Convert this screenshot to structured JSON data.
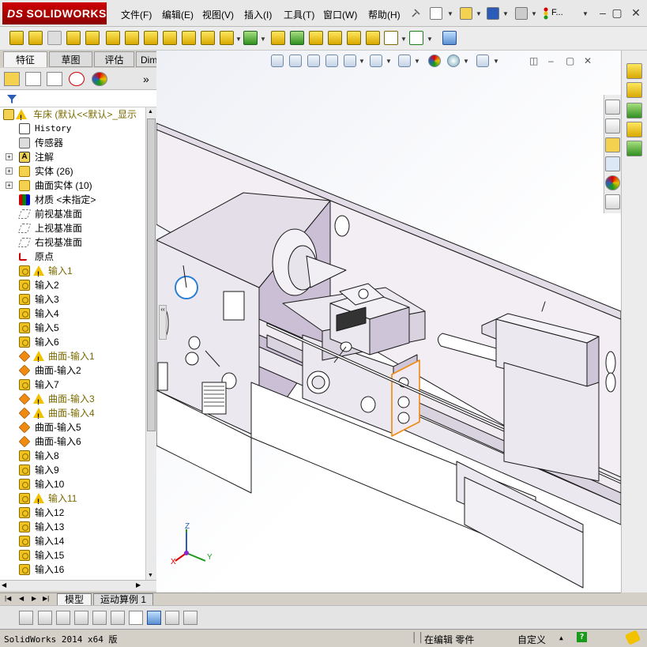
{
  "app": {
    "logo_ds": "DS",
    "logo_text": "SOLIDWORKS",
    "menu": [
      "文件(F)",
      "编辑(E)",
      "视图(V)",
      "插入(I)",
      "工具(T)",
      "窗口(W)",
      "帮助(H)"
    ],
    "quick_extra": "F..."
  },
  "panel_tabs": [
    "特征",
    "草图",
    "评估",
    "DimXpert"
  ],
  "tree": {
    "root": "车床  (默认<<默认>_显示",
    "items": [
      {
        "label": "History",
        "icon": "history-icon",
        "expand": false,
        "warn": false
      },
      {
        "label": "传感器",
        "icon": "sensor-icon",
        "expand": false,
        "warn": false
      },
      {
        "label": "注解",
        "icon": "annotation-icon",
        "expand": true,
        "warn": false
      },
      {
        "label": "实体 (26)",
        "icon": "solid-bodies-icon",
        "expand": true,
        "warn": false
      },
      {
        "label": "曲面实体 (10)",
        "icon": "surface-bodies-icon",
        "expand": true,
        "warn": false
      },
      {
        "label": "材质 <未指定>",
        "icon": "material-icon",
        "expand": false,
        "warn": false
      },
      {
        "label": "前视基准面",
        "icon": "plane-icon",
        "expand": false,
        "warn": false
      },
      {
        "label": "上视基准面",
        "icon": "plane-icon",
        "expand": false,
        "warn": false
      },
      {
        "label": "右视基准面",
        "icon": "plane-icon",
        "expand": false,
        "warn": false
      },
      {
        "label": "原点",
        "icon": "origin-icon",
        "expand": false,
        "warn": false
      },
      {
        "label": "输入1",
        "icon": "import-icon",
        "expand": false,
        "warn": true
      },
      {
        "label": "输入2",
        "icon": "import-icon",
        "expand": false,
        "warn": false
      },
      {
        "label": "输入3",
        "icon": "import-icon",
        "expand": false,
        "warn": false
      },
      {
        "label": "输入4",
        "icon": "import-icon",
        "expand": false,
        "warn": false
      },
      {
        "label": "输入5",
        "icon": "import-icon",
        "expand": false,
        "warn": false
      },
      {
        "label": "输入6",
        "icon": "import-icon",
        "expand": false,
        "warn": false
      },
      {
        "label": "曲面-输入1",
        "icon": "surface-import-icon",
        "expand": false,
        "warn": true
      },
      {
        "label": "曲面-输入2",
        "icon": "surface-import-icon",
        "expand": false,
        "warn": false
      },
      {
        "label": "输入7",
        "icon": "import-icon",
        "expand": false,
        "warn": false
      },
      {
        "label": "曲面-输入3",
        "icon": "surface-import-icon",
        "expand": false,
        "warn": true
      },
      {
        "label": "曲面-输入4",
        "icon": "surface-import-icon",
        "expand": false,
        "warn": true
      },
      {
        "label": "曲面-输入5",
        "icon": "surface-import-icon",
        "expand": false,
        "warn": false
      },
      {
        "label": "曲面-输入6",
        "icon": "surface-import-icon",
        "expand": false,
        "warn": false
      },
      {
        "label": "输入8",
        "icon": "import-icon",
        "expand": false,
        "warn": false
      },
      {
        "label": "输入9",
        "icon": "import-icon",
        "expand": false,
        "warn": false
      },
      {
        "label": "输入10",
        "icon": "import-icon",
        "expand": false,
        "warn": false
      },
      {
        "label": "输入11",
        "icon": "import-icon",
        "expand": false,
        "warn": true
      },
      {
        "label": "输入12",
        "icon": "import-icon",
        "expand": false,
        "warn": false
      },
      {
        "label": "输入13",
        "icon": "import-icon",
        "expand": false,
        "warn": false
      },
      {
        "label": "输入14",
        "icon": "import-icon",
        "expand": false,
        "warn": false
      },
      {
        "label": "输入15",
        "icon": "import-icon",
        "expand": false,
        "warn": false
      },
      {
        "label": "输入16",
        "icon": "import-icon",
        "expand": false,
        "warn": false
      }
    ]
  },
  "bottom_tabs": [
    "模型",
    "运动算例 1"
  ],
  "triad": {
    "x": "X",
    "y": "Y",
    "z": "Z"
  },
  "status": {
    "version": "SolidWorks 2014 x64 版",
    "editing": "在编辑 零件",
    "units": "自定义",
    "help": "?"
  },
  "colors": {
    "accent": "#c00000",
    "model": "#ece8ef",
    "shadow": "#cfc5d8",
    "edge": "#1a1a1a",
    "warning": "#f2c200"
  }
}
